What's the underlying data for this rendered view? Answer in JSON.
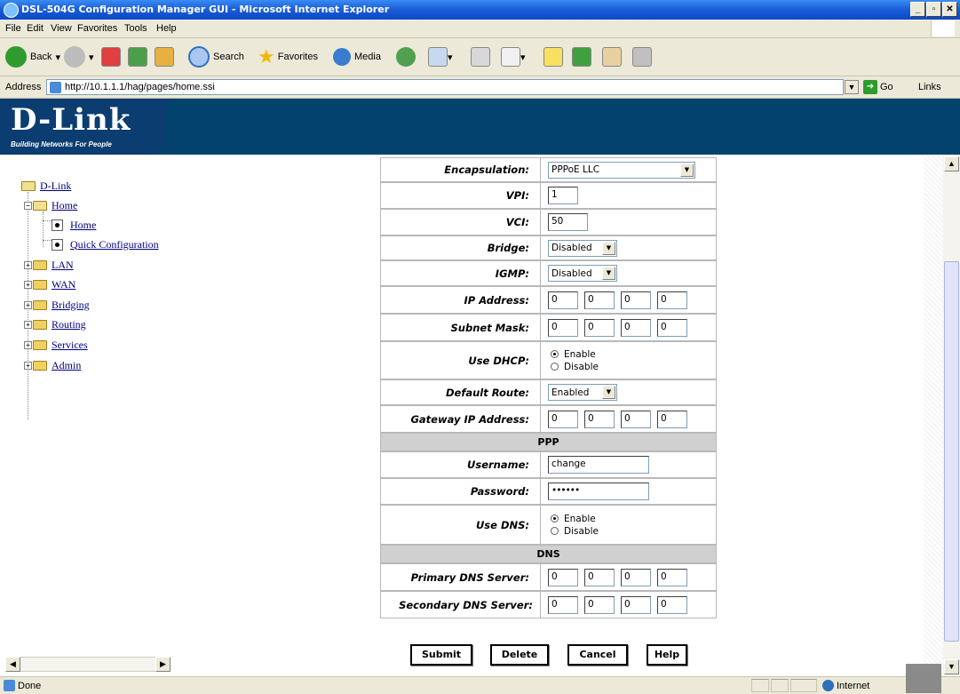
{
  "window": {
    "title": "DSL-504G Configuration Manager GUI - Microsoft Internet Explorer",
    "minimize": "_",
    "maximize": "\u0000",
    "close": "x"
  },
  "menu": [
    "File",
    "Edit",
    "View",
    "Favorites",
    "Tools",
    "Help"
  ],
  "toolbar": {
    "back": "Back",
    "search": "Search",
    "favorites": "Favorites",
    "media": "Media"
  },
  "address": {
    "label": "Address",
    "url": "http://10.1.1.1/hag/pages/home.ssi",
    "go": "Go",
    "links": "Links"
  },
  "brand": {
    "logo": "D-Link",
    "tagline": "Building Networks For People"
  },
  "tree": {
    "root": "D-Link",
    "home": "Home",
    "home_page": "Home",
    "quick_config": "Quick Configuration",
    "lan": "LAN",
    "wan": "WAN",
    "bridging": "Bridging",
    "routing": "Routing",
    "services": "Services",
    "admin": "Admin"
  },
  "form": {
    "encapsulation": {
      "label": "Encapsulation:",
      "value": "PPPoE LLC"
    },
    "vpi": {
      "label": "VPI:",
      "value": "1"
    },
    "vci": {
      "label": "VCI:",
      "value": "50"
    },
    "bridge": {
      "label": "Bridge:",
      "value": "Disabled"
    },
    "igmp": {
      "label": "IGMP:",
      "value": "Disabled"
    },
    "ip_address": {
      "label": "IP Address:",
      "octets": [
        "0",
        "0",
        "0",
        "0"
      ]
    },
    "subnet_mask": {
      "label": "Subnet Mask:",
      "octets": [
        "0",
        "0",
        "0",
        "0"
      ]
    },
    "use_dhcp": {
      "label": "Use DHCP:",
      "enable": "Enable",
      "disable": "Disable",
      "selected": "Enable"
    },
    "default_route": {
      "label": "Default Route:",
      "value": "Enabled"
    },
    "gateway_ip": {
      "label": "Gateway IP Address:",
      "octets": [
        "0",
        "0",
        "0",
        "0"
      ]
    },
    "ppp_section": "PPP",
    "username": {
      "label": "Username:",
      "value": "change"
    },
    "password": {
      "label": "Password:",
      "value": "••••••"
    },
    "use_dns": {
      "label": "Use DNS:",
      "enable": "Enable",
      "disable": "Disable",
      "selected": "Enable"
    },
    "dns_section": "DNS",
    "primary_dns": {
      "label": "Primary DNS Server:",
      "octets": [
        "0",
        "0",
        "0",
        "0"
      ]
    },
    "secondary_dns": {
      "label": "Secondary DNS Server:",
      "octets": [
        "0",
        "0",
        "0",
        "0"
      ]
    }
  },
  "buttons": {
    "submit": "Submit",
    "delete": "Delete",
    "cancel": "Cancel",
    "help": "Help"
  },
  "status": {
    "text": "Done",
    "zone": "Internet"
  }
}
